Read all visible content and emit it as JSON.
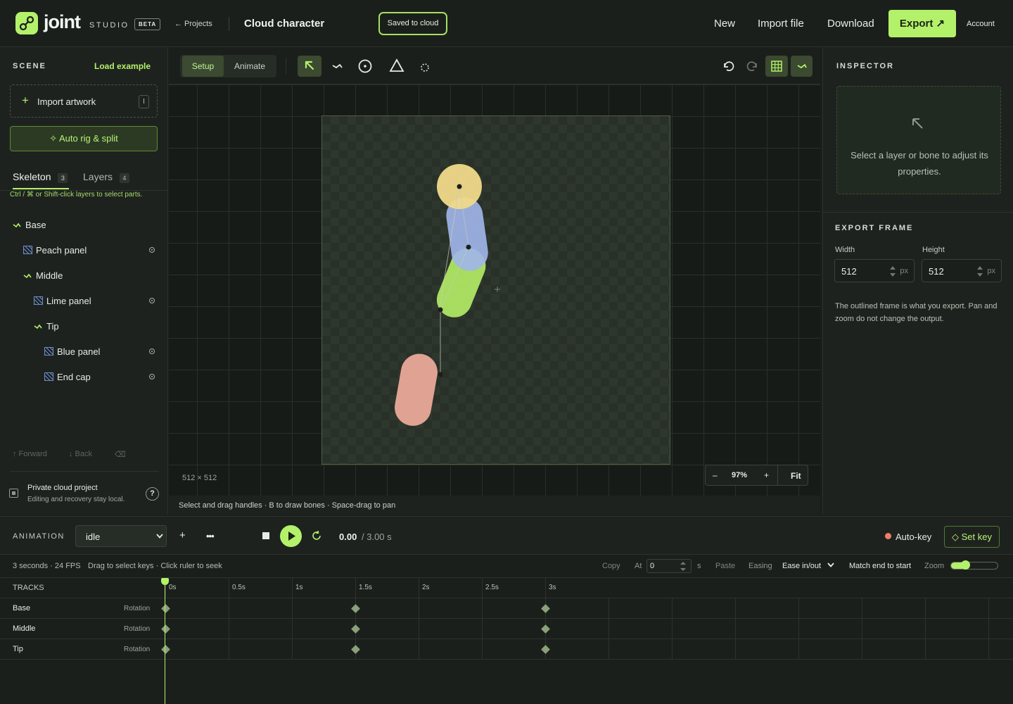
{
  "header": {
    "brand": "joint",
    "brand_sub": "STUDIO",
    "beta": "BETA",
    "projects_link": "← Projects",
    "project_title": "Cloud character",
    "save_status": "Saved to cloud",
    "nav": [
      "New",
      "Import file",
      "Download"
    ],
    "export_label": "Export ↗",
    "account": "Account"
  },
  "scene": {
    "title": "SCENE",
    "load_example": "Load example",
    "import_artwork": "Import artwork",
    "import_shortcut": "I",
    "auto_rig": "✧ Auto rig & split",
    "tabs": [
      {
        "label": "Skeleton",
        "count": "3"
      },
      {
        "label": "Layers",
        "count": "4"
      }
    ],
    "hint": "Ctrl / ⌘ or Shift-click layers to select parts.",
    "tree": [
      {
        "label": "Base",
        "type": "bone",
        "depth": 0
      },
      {
        "label": "Peach panel",
        "type": "layer",
        "depth": 1
      },
      {
        "label": "Middle",
        "type": "bone",
        "depth": 1
      },
      {
        "label": "Lime panel",
        "type": "layer",
        "depth": 2
      },
      {
        "label": "Tip",
        "type": "bone",
        "depth": 2
      },
      {
        "label": "Blue panel",
        "type": "layer",
        "depth": 3
      },
      {
        "label": "End cap",
        "type": "layer",
        "depth": 3
      }
    ],
    "forward": "↑ Forward",
    "back": "↓ Back",
    "private_title": "Private cloud project",
    "private_desc": "Editing and recovery stay local.",
    "help": "?"
  },
  "toolbar": {
    "modes": [
      "Setup",
      "Animate"
    ],
    "active_mode": "Setup"
  },
  "canvas": {
    "frame_size": "512 × 512",
    "zoom_minus": "–",
    "zoom_value": "97%",
    "zoom_plus": "+",
    "fit": "Fit",
    "status_hint": "Select and drag handles · B to draw bones · Space-drag to pan"
  },
  "inspector": {
    "title": "INSPECTOR",
    "empty_text": "Select a layer or bone to adjust its properties.",
    "export_frame_title": "EXPORT FRAME",
    "width_label": "Width",
    "width_value": "512",
    "height_label": "Height",
    "height_value": "512",
    "unit": "px",
    "note": "The outlined frame is what you export. Pan and zoom do not change the output."
  },
  "animation": {
    "title": "ANIMATION",
    "clip": "idle",
    "add": "+",
    "more": "•••",
    "time_current": "0.00",
    "time_total": "/ 3.00 s",
    "autokey": "Auto-key",
    "set_key": "◇ Set key",
    "info": "3 seconds · 24 FPS",
    "drag_hint": "Drag to select keys · Click ruler to seek",
    "copy": "Copy",
    "at_label": "At",
    "at_value": "0",
    "at_unit": "s",
    "paste": "Paste",
    "easing_label": "Easing",
    "easing_value": "Ease in/out",
    "match": "Match end to start",
    "zoom_label": "Zoom",
    "zoom_level": 0.3,
    "tracks_label": "TRACKS",
    "ruler": [
      "0s",
      "0.5s",
      "1s",
      "1.5s",
      "2s",
      "2.5s",
      "3s"
    ],
    "tracks": [
      {
        "name": "Base",
        "property": "Rotation",
        "keys": [
          0,
          1.5,
          3
        ]
      },
      {
        "name": "Middle",
        "property": "Rotation",
        "keys": [
          0,
          1.5,
          3
        ]
      },
      {
        "name": "Tip",
        "property": "Rotation",
        "keys": [
          0,
          1.5,
          3
        ]
      }
    ],
    "playhead": 0
  },
  "colors": {
    "accent": "#b3f16a",
    "peach": "#f0ad9c",
    "lime": "#b2ec65",
    "blue": "#9fb5e8",
    "yellow": "#f0d98a"
  }
}
